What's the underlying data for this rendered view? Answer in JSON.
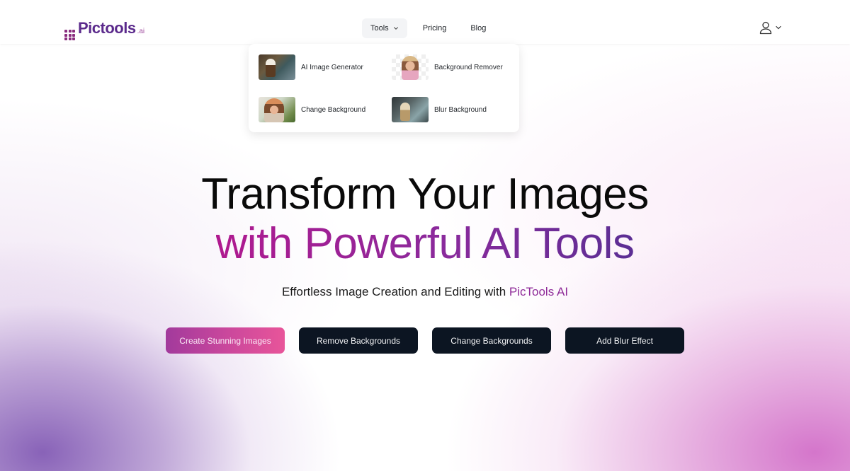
{
  "brand": {
    "name": "Pictools",
    "suffix": ".ai"
  },
  "nav": {
    "links": [
      {
        "label": "Tools",
        "has_dropdown": true,
        "active": true
      },
      {
        "label": "Pricing"
      },
      {
        "label": "Blog"
      }
    ],
    "user_icon": "user-icon",
    "user_chevron": "chevron-down-icon"
  },
  "tools_menu": {
    "items": [
      {
        "label": "AI Image Generator",
        "thumbnail": "eagle-landscape-thumbnail"
      },
      {
        "label": "Background Remover",
        "thumbnail": "woman-transparent-bg-thumbnail"
      },
      {
        "label": "Change Background",
        "thumbnail": "woman-hat-garden-thumbnail"
      },
      {
        "label": "Blur Background",
        "thumbnail": "meerkat-blur-thumbnail"
      }
    ]
  },
  "hero": {
    "title_line1": "Transform Your Images",
    "title_line2": "with Powerful AI Tools",
    "subtitle_prefix": "Effortless Image Creation and Editing with ",
    "subtitle_brand": "PicTools AI"
  },
  "cta_buttons": [
    {
      "label": "Create Stunning Images",
      "style": "primary"
    },
    {
      "label": "Remove Backgrounds",
      "style": "dark"
    },
    {
      "label": "Change Backgrounds",
      "style": "dark"
    },
    {
      "label": "Add Blur Effect",
      "style": "dark"
    }
  ],
  "colors": {
    "brand_purple": "#5b2a8c",
    "accent_magenta": "#b0198f",
    "button_dark": "#0c1522",
    "button_primary_start": "#a23a9c",
    "button_primary_end": "#e8559a"
  }
}
